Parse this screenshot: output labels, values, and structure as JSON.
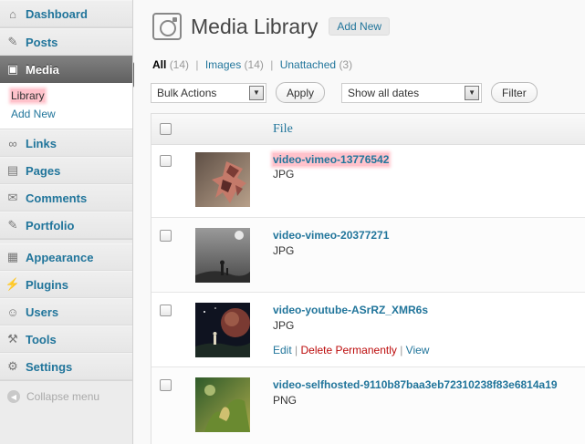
{
  "sidebar": {
    "items": [
      {
        "label": "Dashboard",
        "icon": "dashboard-icon",
        "glyph": "⌂"
      },
      {
        "label": "Posts",
        "icon": "pushpin-icon",
        "glyph": "✎"
      },
      {
        "label": "Media",
        "icon": "media-icon",
        "glyph": "▣"
      },
      {
        "label": "Links",
        "icon": "link-icon",
        "glyph": "∞"
      },
      {
        "label": "Pages",
        "icon": "pages-icon",
        "glyph": "▤"
      },
      {
        "label": "Comments",
        "icon": "comment-bubble-icon",
        "glyph": "✉"
      },
      {
        "label": "Portfolio",
        "icon": "pushpin-icon",
        "glyph": "✎"
      },
      {
        "label": "Appearance",
        "icon": "appearance-icon",
        "glyph": "▦"
      },
      {
        "label": "Plugins",
        "icon": "plug-icon",
        "glyph": "⚡"
      },
      {
        "label": "Users",
        "icon": "users-icon",
        "glyph": "☺"
      },
      {
        "label": "Tools",
        "icon": "tools-icon",
        "glyph": "⚒"
      },
      {
        "label": "Settings",
        "icon": "settings-icon",
        "glyph": "⚙"
      }
    ],
    "submenu": [
      {
        "label": "Library"
      },
      {
        "label": "Add New"
      }
    ],
    "collapse_label": "Collapse menu"
  },
  "header": {
    "title": "Media Library",
    "add_new_label": "Add New"
  },
  "views": [
    {
      "label": "All",
      "count": "(14)"
    },
    {
      "label": "Images",
      "count": "(14)"
    },
    {
      "label": "Unattached",
      "count": "(3)"
    }
  ],
  "tablenav": {
    "bulk_actions": "Bulk Actions",
    "apply_label": "Apply",
    "date_filter": "Show all dates",
    "filter_label": "Filter"
  },
  "table": {
    "column_file": "File",
    "rows": [
      {
        "title": "video-vimeo-13776542",
        "type": "JPG"
      },
      {
        "title": "video-vimeo-20377271",
        "type": "JPG"
      },
      {
        "title": "video-youtube-ASrRZ_XMR6s",
        "type": "JPG",
        "actions": {
          "edit": "Edit",
          "delete": "Delete Permanently",
          "view": "View"
        }
      },
      {
        "title": "video-selfhosted-9110b87baa3eb72310238f83e6814a19",
        "type": "PNG"
      }
    ]
  },
  "colors": {
    "link": "#21759b",
    "delete": "#bc0b0b",
    "active_menu": "#6d6d6d"
  }
}
